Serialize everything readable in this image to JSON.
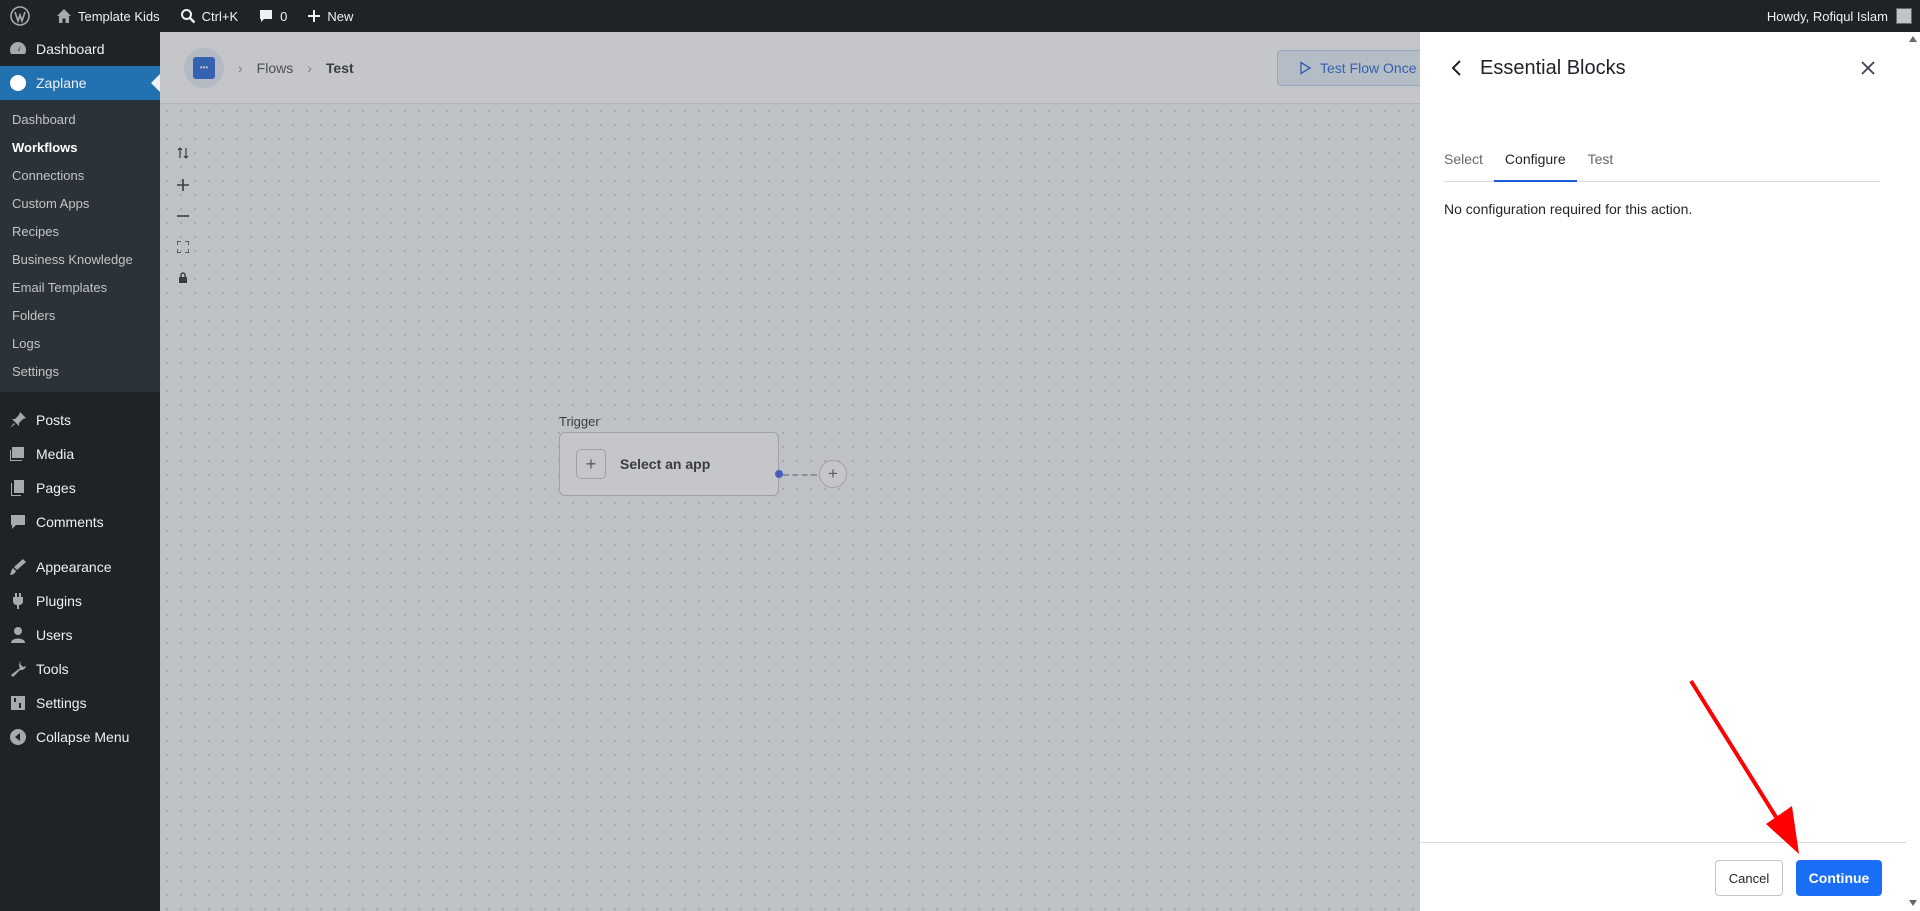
{
  "adminbar": {
    "site_name": "Template Kids",
    "search_shortcut": "Ctrl+K",
    "comments_count": "0",
    "new_label": "New",
    "howdy": "Howdy, Rofiqul Islam"
  },
  "menu": {
    "dashboard": "Dashboard",
    "zaplane": "Zaplane",
    "submenu": [
      "Dashboard",
      "Workflows",
      "Connections",
      "Custom Apps",
      "Recipes",
      "Business Knowledge",
      "Email Templates",
      "Folders",
      "Logs",
      "Settings"
    ],
    "posts": "Posts",
    "media": "Media",
    "pages": "Pages",
    "comments": "Comments",
    "appearance": "Appearance",
    "plugins": "Plugins",
    "users": "Users",
    "tools": "Tools",
    "settings": "Settings",
    "collapse": "Collapse Menu"
  },
  "flow": {
    "breadcrumb_flows": "Flows",
    "breadcrumb_current": "Test",
    "test_button": "Test Flow Once",
    "trigger_label": "Trigger",
    "node_text": "Select an app"
  },
  "panel": {
    "title": "Essential Blocks",
    "tabs": [
      "Select",
      "Configure",
      "Test"
    ],
    "message": "No configuration required for this action.",
    "cancel": "Cancel",
    "continue": "Continue"
  },
  "colors": {
    "accent": "#1a6ef5",
    "admin_bg": "#1d2327",
    "menu_current": "#2271b1",
    "annotation": "#ff0000"
  }
}
